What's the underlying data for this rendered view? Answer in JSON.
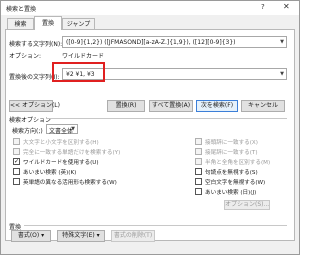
{
  "window": {
    "title": "検索と置換",
    "help": "?",
    "close": "✕"
  },
  "tabs": [
    {
      "label": "検索",
      "active": false
    },
    {
      "label": "置換",
      "active": true
    },
    {
      "label": "ジャンプ",
      "active": false
    }
  ],
  "find": {
    "label": "検索する文字列(N):",
    "value": "([0-9]{1,2}) ([JFMASOND][a-zA-Z.]{1,9}), ([12][0-9]{3})",
    "options_label": "オプション:",
    "options_value": "ワイルドカード"
  },
  "replace": {
    "label": "置換後の文字列(I):",
    "value": "¥2 ¥1, ¥3"
  },
  "buttons": {
    "less": "<< オプション(L)",
    "replace": "置換(R)",
    "replace_all": "すべて置換(A)",
    "find_next": "次を検索(F)",
    "cancel": "キャンセル"
  },
  "search_options": {
    "section_label": "検索オプション",
    "direction_label": "検索方向(;)",
    "direction_value": "文書全体",
    "left": [
      {
        "label": "大文字と小文字を区別する(H)",
        "checked": false,
        "disabled": true
      },
      {
        "label": "完全に一致する単語だけを検索する(Y)",
        "checked": false,
        "disabled": true
      },
      {
        "label": "ワイルドカードを使用する(U)",
        "checked": true,
        "disabled": false
      },
      {
        "label": "あいまい検索 (英)(K)",
        "checked": false,
        "disabled": false
      },
      {
        "label": "英単語の異なる活用形も検索する(W)",
        "checked": false,
        "disabled": false
      }
    ],
    "right": [
      {
        "label": "接頭辞に一致する(X)",
        "checked": false,
        "disabled": true
      },
      {
        "label": "接尾辞に一致する(T)",
        "checked": false,
        "disabled": true
      },
      {
        "label": "半角と全角を区別する(M)",
        "checked": false,
        "disabled": true
      },
      {
        "label": "句読点を無視する(S)",
        "checked": false,
        "disabled": false
      },
      {
        "label": "空白文字を無視する(W)",
        "checked": false,
        "disabled": false
      },
      {
        "label": "あいまい検索 (日)(J)",
        "checked": false,
        "disabled": false
      }
    ],
    "options_btn": "オプション(S)..."
  },
  "replace_section": {
    "label": "置換",
    "format_btn": "書式(O) ▾",
    "special_btn": "特殊文字(E) ▾",
    "no_format_btn": "書式の削除(T)"
  }
}
